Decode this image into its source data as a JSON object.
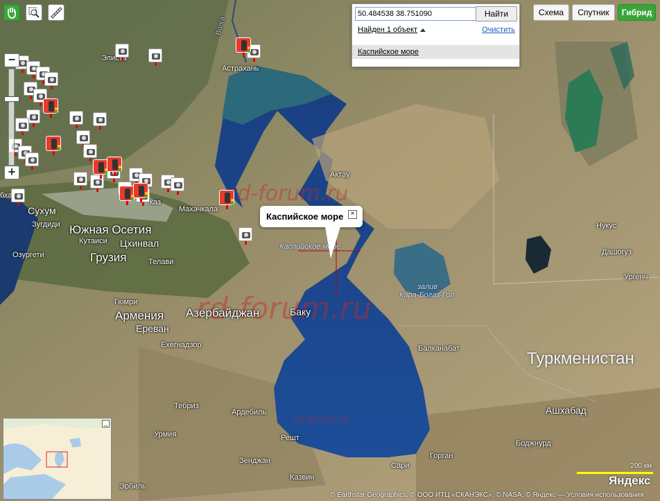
{
  "toolbar": {
    "tools": [
      {
        "name": "hand-tool",
        "icon": "hand-icon"
      },
      {
        "name": "magnifier-tool",
        "icon": "magnifier-icon"
      },
      {
        "name": "ruler-tool",
        "icon": "ruler-icon"
      }
    ]
  },
  "search": {
    "query": "50.484538 38.751090",
    "find_label": "Найти",
    "found_label": "Найден 1 объект",
    "clear_label": "Очистить",
    "result_label": "Каспийское море"
  },
  "map_types": {
    "scheme": "Схема",
    "satellite": "Спутник",
    "hybrid": "Гибрид",
    "active": "hybrid"
  },
  "balloon": {
    "title": "Каспийское море",
    "close_glyph": "×"
  },
  "labels": {
    "astrakhan": "Астрахань",
    "elista": "Элиста",
    "aktau": "Актау",
    "sukhum": "Сухум",
    "zugdidi": "Зугдиди",
    "south_ossetia": "Южная Осетия",
    "kutaisi": "Кутаиси",
    "tskhinval": "Цхинвал",
    "ozurgeti": "Озургети",
    "georgia": "Грузия",
    "telavi": "Телави",
    "makhachkala": "Махачкала",
    "vladikavkaz_part": "каз",
    "caspian_sea": "Каспийское море",
    "kara_bogaz_1": "залив",
    "kara_bogaz_2": "Кара-Богаз-Гол",
    "gyumri": "Гюмри",
    "armenia": "Армения",
    "yerevan": "Ереван",
    "azerbaijan": "Азербайджан",
    "baku": "Баку",
    "khegnadzor": "Ехегнадзор",
    "balkanabat": "Балканабат",
    "turkmenistan": "Туркменистан",
    "tebriz": "Тебриз",
    "ardebil": "Ардебиль",
    "urmia": "Урмия",
    "resht": "Решт",
    "zendzhan": "Зенджан",
    "kazvin": "Казвин",
    "erbil": "Эрбиль",
    "sari": "Сари",
    "gorgan": "Горган",
    "ashgabat": "Ашхабад",
    "bodzhnurd": "Боджнурд",
    "nukus": "Нукус",
    "dashoguz": "Дашогуз",
    "urgench": "Ургенч",
    "abkhazia_part": "бхазия",
    "river_v": "Волга"
  },
  "watermarks": [
    "rd-forum.ru",
    "rd-forum.ru",
    "rd-forum.ru"
  ],
  "scale": {
    "label": "200 км"
  },
  "copyright": "© Earthstar Geographics, © ООО ИТЦ «СКАНЭКС», © NASA, © Яндекс — Условия использования",
  "logo": "Яндекс",
  "colors": {
    "hybrid_active": "#3aa63a",
    "sea": "#1e4e9a",
    "link": "#1a5bc4"
  },
  "icons": {
    "camera": "traffic-camera-icon",
    "light": "traffic-light-icon"
  }
}
